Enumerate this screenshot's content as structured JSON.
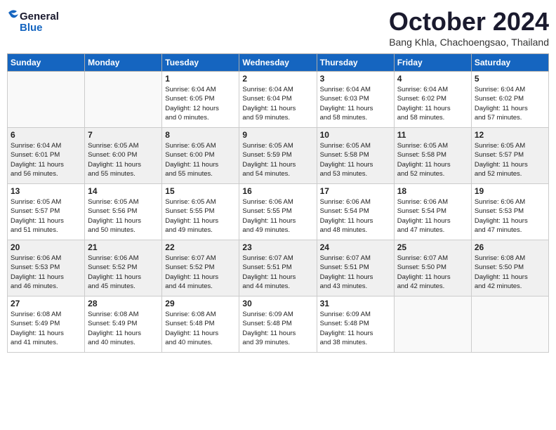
{
  "logo": {
    "line1": "General",
    "line2": "Blue"
  },
  "title": "October 2024",
  "location": "Bang Khla, Chachoengsao, Thailand",
  "days_of_week": [
    "Sunday",
    "Monday",
    "Tuesday",
    "Wednesday",
    "Thursday",
    "Friday",
    "Saturday"
  ],
  "weeks": [
    [
      {
        "day": "",
        "info": ""
      },
      {
        "day": "",
        "info": ""
      },
      {
        "day": "1",
        "info": "Sunrise: 6:04 AM\nSunset: 6:05 PM\nDaylight: 12 hours\nand 0 minutes."
      },
      {
        "day": "2",
        "info": "Sunrise: 6:04 AM\nSunset: 6:04 PM\nDaylight: 11 hours\nand 59 minutes."
      },
      {
        "day": "3",
        "info": "Sunrise: 6:04 AM\nSunset: 6:03 PM\nDaylight: 11 hours\nand 58 minutes."
      },
      {
        "day": "4",
        "info": "Sunrise: 6:04 AM\nSunset: 6:02 PM\nDaylight: 11 hours\nand 58 minutes."
      },
      {
        "day": "5",
        "info": "Sunrise: 6:04 AM\nSunset: 6:02 PM\nDaylight: 11 hours\nand 57 minutes."
      }
    ],
    [
      {
        "day": "6",
        "info": "Sunrise: 6:04 AM\nSunset: 6:01 PM\nDaylight: 11 hours\nand 56 minutes."
      },
      {
        "day": "7",
        "info": "Sunrise: 6:05 AM\nSunset: 6:00 PM\nDaylight: 11 hours\nand 55 minutes."
      },
      {
        "day": "8",
        "info": "Sunrise: 6:05 AM\nSunset: 6:00 PM\nDaylight: 11 hours\nand 55 minutes."
      },
      {
        "day": "9",
        "info": "Sunrise: 6:05 AM\nSunset: 5:59 PM\nDaylight: 11 hours\nand 54 minutes."
      },
      {
        "day": "10",
        "info": "Sunrise: 6:05 AM\nSunset: 5:58 PM\nDaylight: 11 hours\nand 53 minutes."
      },
      {
        "day": "11",
        "info": "Sunrise: 6:05 AM\nSunset: 5:58 PM\nDaylight: 11 hours\nand 52 minutes."
      },
      {
        "day": "12",
        "info": "Sunrise: 6:05 AM\nSunset: 5:57 PM\nDaylight: 11 hours\nand 52 minutes."
      }
    ],
    [
      {
        "day": "13",
        "info": "Sunrise: 6:05 AM\nSunset: 5:57 PM\nDaylight: 11 hours\nand 51 minutes."
      },
      {
        "day": "14",
        "info": "Sunrise: 6:05 AM\nSunset: 5:56 PM\nDaylight: 11 hours\nand 50 minutes."
      },
      {
        "day": "15",
        "info": "Sunrise: 6:05 AM\nSunset: 5:55 PM\nDaylight: 11 hours\nand 49 minutes."
      },
      {
        "day": "16",
        "info": "Sunrise: 6:06 AM\nSunset: 5:55 PM\nDaylight: 11 hours\nand 49 minutes."
      },
      {
        "day": "17",
        "info": "Sunrise: 6:06 AM\nSunset: 5:54 PM\nDaylight: 11 hours\nand 48 minutes."
      },
      {
        "day": "18",
        "info": "Sunrise: 6:06 AM\nSunset: 5:54 PM\nDaylight: 11 hours\nand 47 minutes."
      },
      {
        "day": "19",
        "info": "Sunrise: 6:06 AM\nSunset: 5:53 PM\nDaylight: 11 hours\nand 47 minutes."
      }
    ],
    [
      {
        "day": "20",
        "info": "Sunrise: 6:06 AM\nSunset: 5:53 PM\nDaylight: 11 hours\nand 46 minutes."
      },
      {
        "day": "21",
        "info": "Sunrise: 6:06 AM\nSunset: 5:52 PM\nDaylight: 11 hours\nand 45 minutes."
      },
      {
        "day": "22",
        "info": "Sunrise: 6:07 AM\nSunset: 5:52 PM\nDaylight: 11 hours\nand 44 minutes."
      },
      {
        "day": "23",
        "info": "Sunrise: 6:07 AM\nSunset: 5:51 PM\nDaylight: 11 hours\nand 44 minutes."
      },
      {
        "day": "24",
        "info": "Sunrise: 6:07 AM\nSunset: 5:51 PM\nDaylight: 11 hours\nand 43 minutes."
      },
      {
        "day": "25",
        "info": "Sunrise: 6:07 AM\nSunset: 5:50 PM\nDaylight: 11 hours\nand 42 minutes."
      },
      {
        "day": "26",
        "info": "Sunrise: 6:08 AM\nSunset: 5:50 PM\nDaylight: 11 hours\nand 42 minutes."
      }
    ],
    [
      {
        "day": "27",
        "info": "Sunrise: 6:08 AM\nSunset: 5:49 PM\nDaylight: 11 hours\nand 41 minutes."
      },
      {
        "day": "28",
        "info": "Sunrise: 6:08 AM\nSunset: 5:49 PM\nDaylight: 11 hours\nand 40 minutes."
      },
      {
        "day": "29",
        "info": "Sunrise: 6:08 AM\nSunset: 5:48 PM\nDaylight: 11 hours\nand 40 minutes."
      },
      {
        "day": "30",
        "info": "Sunrise: 6:09 AM\nSunset: 5:48 PM\nDaylight: 11 hours\nand 39 minutes."
      },
      {
        "day": "31",
        "info": "Sunrise: 6:09 AM\nSunset: 5:48 PM\nDaylight: 11 hours\nand 38 minutes."
      },
      {
        "day": "",
        "info": ""
      },
      {
        "day": "",
        "info": ""
      }
    ]
  ]
}
